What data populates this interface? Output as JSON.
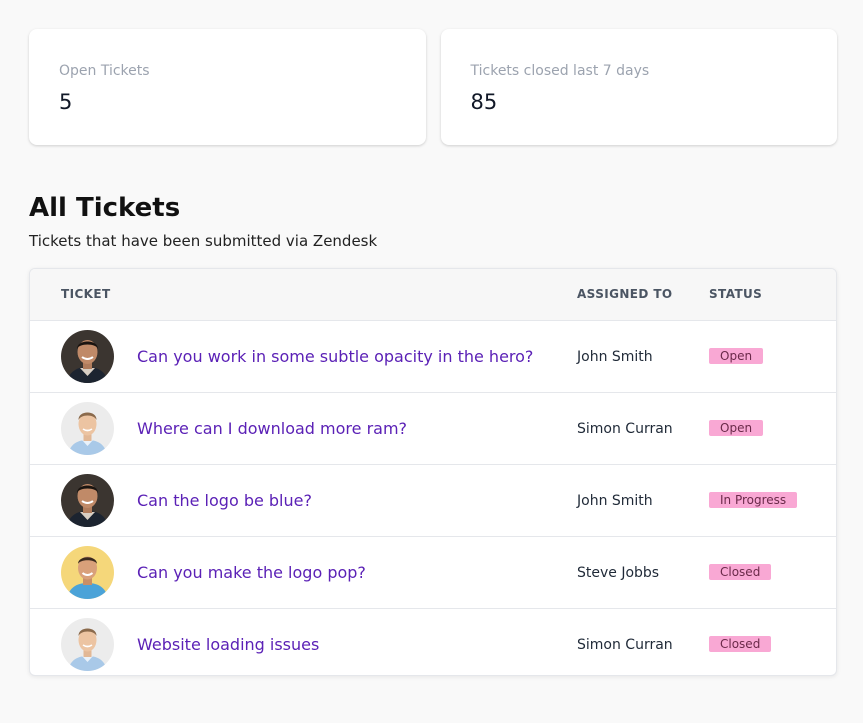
{
  "stats": [
    {
      "label": "Open Tickets",
      "value": "5"
    },
    {
      "label": "Tickets closed last 7 days",
      "value": "85"
    }
  ],
  "section": {
    "title": "All Tickets",
    "subtitle": "Tickets that have been submitted via Zendesk"
  },
  "table": {
    "headers": {
      "ticket": "TICKET",
      "assigned_to": "ASSIGNED TO",
      "status": "STATUS"
    },
    "rows": [
      {
        "title": "Can you work in some subtle opacity in the hero?",
        "assignee": "John Smith",
        "status": "Open",
        "avatar": "avatar-dark-bg-man"
      },
      {
        "title": "Where can I download more ram?",
        "assignee": "Simon Curran",
        "status": "Open",
        "avatar": "avatar-light-bg-man"
      },
      {
        "title": "Can the logo be blue?",
        "assignee": "John Smith",
        "status": "In Progress",
        "avatar": "avatar-dark-bg-man"
      },
      {
        "title": "Can you make the logo pop?",
        "assignee": "Steve Jobbs",
        "status": "Closed",
        "avatar": "avatar-yellow-bg-man"
      },
      {
        "title": "Website loading issues",
        "assignee": "Simon Curran",
        "status": "Closed",
        "avatar": "avatar-light-bg-man"
      }
    ]
  },
  "colors": {
    "link": "#5b21b6",
    "badge_bg": "#f9a8d4",
    "page_bg": "#f9f9f9"
  }
}
